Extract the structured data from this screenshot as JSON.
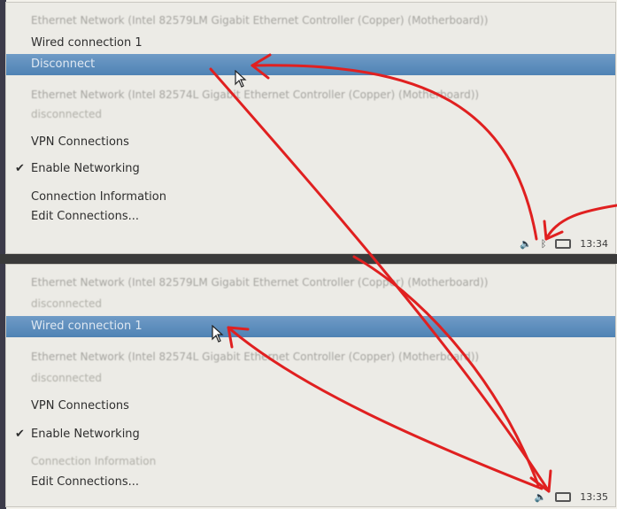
{
  "top_menu": {
    "network_header": "Ethernet Network (Intel 82579LM Gigabit Ethernet Controller (Copper) (Motherboard))",
    "wired_label": "Wired connection 1",
    "disconnect_label": "Disconnect",
    "second_network_header": "Ethernet Network (Intel 82574L Gigabit Ethernet Controller (Copper) (Motherboard))",
    "second_status": "disconnected",
    "vpn_label": "VPN Connections",
    "enable_networking_label": "Enable Networking",
    "check_mark": "✔",
    "connection_info_label": "Connection Information",
    "edit_connections_label": "Edit Connections..."
  },
  "top_tray": {
    "volume_icon": "speaker-icon",
    "time": "13:34"
  },
  "bottom_menu": {
    "network_header": "Ethernet Network (Intel 82579LM Gigabit Ethernet Controller (Copper) (Motherboard))",
    "connecting_label": "disconnected",
    "wired_label": "Wired connection 1",
    "second_network_header": "Ethernet Network (Intel 82574L Gigabit Ethernet Controller (Copper) (Motherboard))",
    "second_status": "disconnected",
    "vpn_label": "VPN Connections",
    "enable_networking_label": "Enable Networking",
    "check_mark": "✔",
    "connection_info_label": "Connection Information",
    "edit_connections_label": "Edit Connections..."
  },
  "bottom_tray": {
    "time": "13:35"
  },
  "colors": {
    "highlight": "#5a8cbd",
    "arrow": "#e02020",
    "menu_bg": "#ecebe6"
  }
}
